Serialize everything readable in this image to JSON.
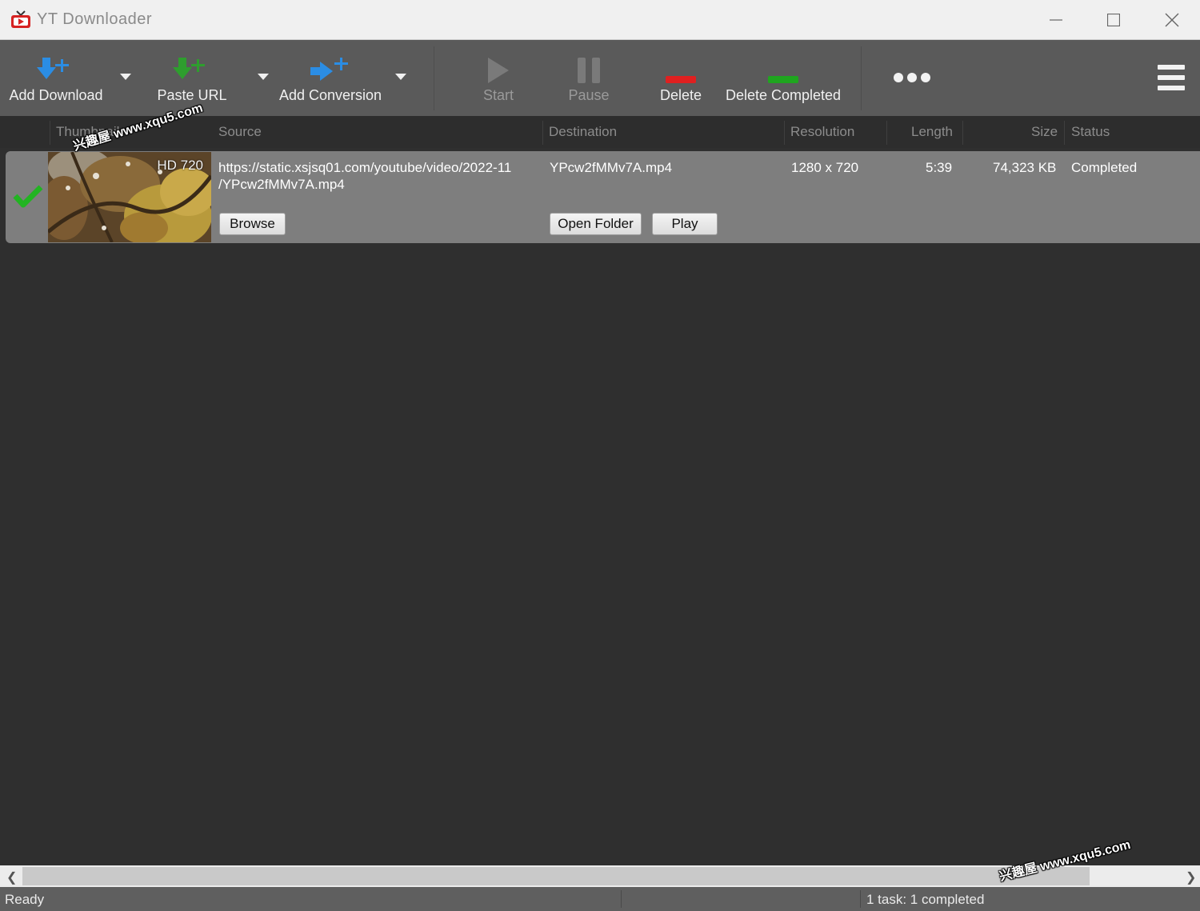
{
  "window": {
    "title": "YT Downloader"
  },
  "toolbar": {
    "add_download": "Add Download",
    "paste_url": "Paste URL",
    "add_conversion": "Add Conversion",
    "start": "Start",
    "pause": "Pause",
    "delete": "Delete",
    "delete_completed": "Delete Completed"
  },
  "columns": {
    "thumbnail": "Thumbnail",
    "source": "Source",
    "destination": "Destination",
    "resolution": "Resolution",
    "length": "Length",
    "size": "Size",
    "status": "Status"
  },
  "download": {
    "badge": "HD 720",
    "source_line1": "https://static.xsjsq01.com/youtube/video/2022-11",
    "source_line2": "/YPcw2fMMv7A.mp4",
    "destination": "YPcw2fMMv7A.mp4",
    "resolution": "1280 x 720",
    "length": "5:39",
    "size": "74,323 KB",
    "status": "Completed",
    "browse": "Browse",
    "open_folder": "Open Folder",
    "play": "Play"
  },
  "statusbar": {
    "left": "Ready",
    "right": "1 task: 1 completed"
  },
  "watermark": {
    "text": "兴趣屋 www.xqu5.com"
  },
  "colors": {
    "add_blue": "#2b8de4",
    "paste_green": "#2e9e2e",
    "delete_red": "#e02020",
    "delete_completed_green": "#1fa51f",
    "check_green": "#22b422"
  }
}
